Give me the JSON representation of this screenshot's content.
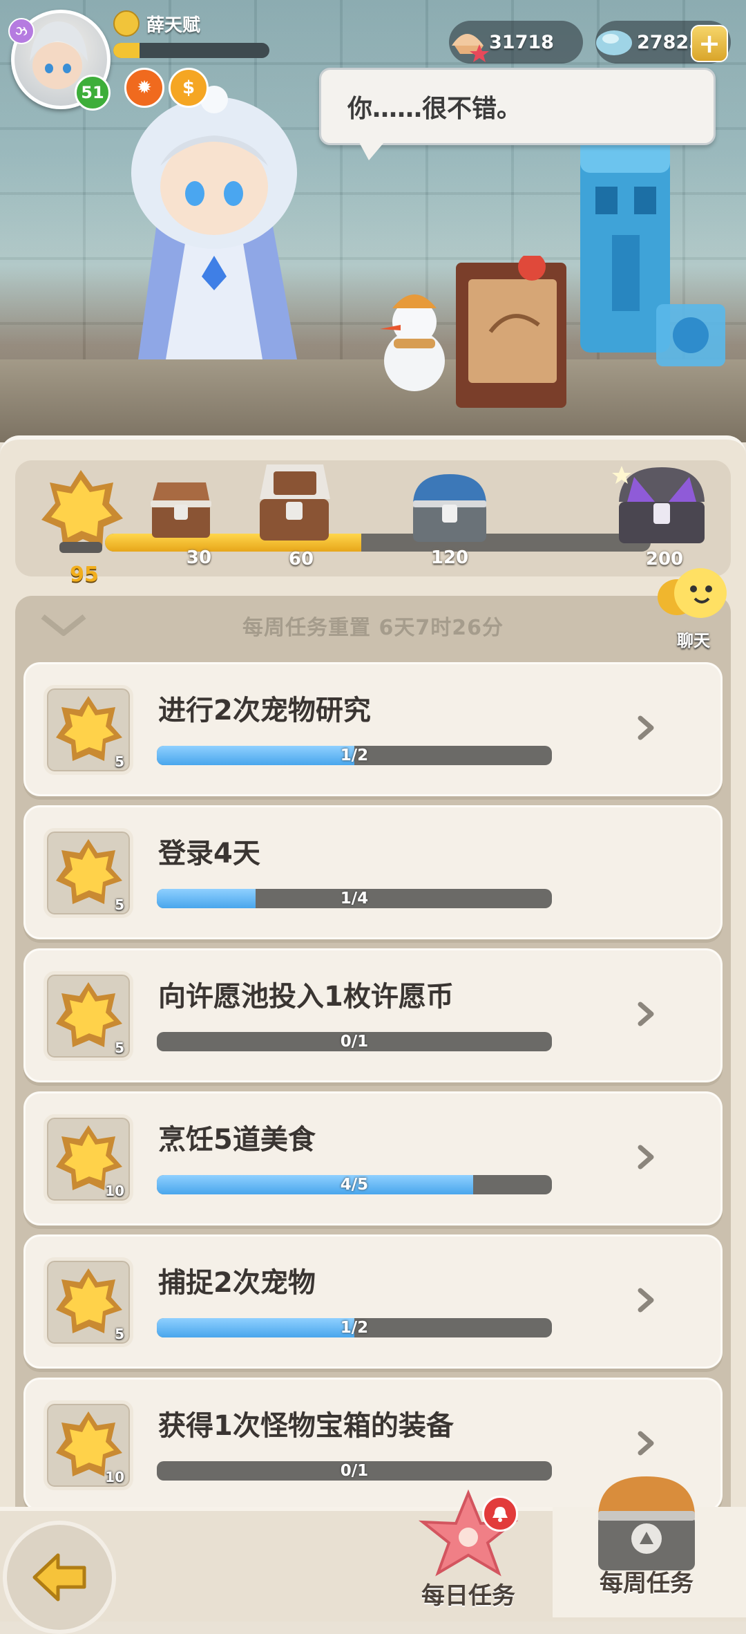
{
  "player": {
    "name": "薛天赋",
    "level": "51",
    "exp_fraction": 0.17
  },
  "currencies": {
    "shells": "31718",
    "gems": "27825",
    "add_label": "+"
  },
  "dialog": {
    "text": "你……很不错。"
  },
  "milestones": {
    "current_points": "95",
    "max_points": 200,
    "progress_fraction": 0.47,
    "chests": [
      {
        "label": "30",
        "points": 30
      },
      {
        "label": "60",
        "points": 60
      },
      {
        "label": "120",
        "points": 120
      },
      {
        "label": "200",
        "points": 200
      }
    ]
  },
  "weekly": {
    "reset_text": "每周任务重置  6天7时26分",
    "chat_label": "聊天"
  },
  "tasks": [
    {
      "title": "进行2次宠物研究",
      "reward": "5",
      "progress": "1/2",
      "fraction": 0.5,
      "has_arrow": true
    },
    {
      "title": "登录4天",
      "reward": "5",
      "progress": "1/4",
      "fraction": 0.25,
      "has_arrow": false
    },
    {
      "title": "向许愿池投入1枚许愿币",
      "reward": "5",
      "progress": "0/1",
      "fraction": 0,
      "has_arrow": true
    },
    {
      "title": "烹饪5道美食",
      "reward": "10",
      "progress": "4/5",
      "fraction": 0.8,
      "has_arrow": true
    },
    {
      "title": "捕捉2次宠物",
      "reward": "5",
      "progress": "1/2",
      "fraction": 0.5,
      "has_arrow": true
    },
    {
      "title": "获得1次怪物宝箱的装备",
      "reward": "10",
      "progress": "0/1",
      "fraction": 0,
      "has_arrow": true
    }
  ],
  "tabs": {
    "daily": "每日任务",
    "weekly": "每周任务"
  },
  "icons": {
    "avatar": "avatar-icon",
    "shell": "shell-icon",
    "gem": "gem-icon",
    "star_medal": "star-medal-icon",
    "chest": "chest-icon",
    "chevron": "chevron-right-icon",
    "back": "back-arrow-icon",
    "chat": "chat-bubble-icon"
  },
  "colors": {
    "accent_gold": "#f2ae1c",
    "progress_blue": "#49a6ec",
    "badge_green": "#3dae3a",
    "alert_red": "#e23b3b"
  }
}
